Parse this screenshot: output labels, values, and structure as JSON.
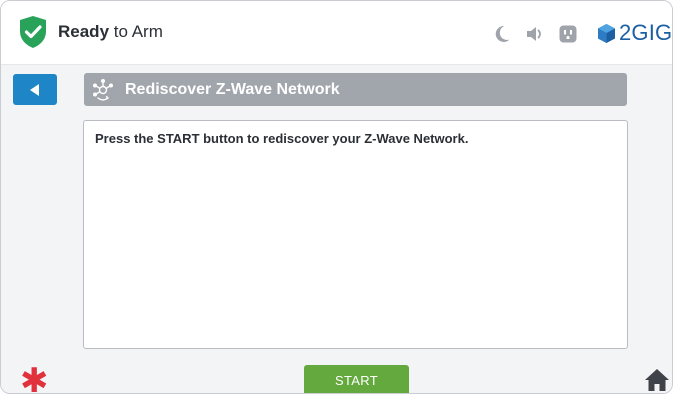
{
  "status": {
    "state_bold": "Ready",
    "state_rest": " to Arm",
    "icons": [
      "shield-check-icon",
      "moon-icon",
      "speaker-icon",
      "power-outlet-icon"
    ]
  },
  "brand": {
    "logo_text": "2GIG"
  },
  "header": {
    "back_icon": "back-arrow-icon",
    "title": "Rediscover Z-Wave Network",
    "title_icon": "zwave-network-icon"
  },
  "message": {
    "text": "Press the START button to rediscover your Z-Wave Network."
  },
  "footer": {
    "star_icon": "emergency-star-icon",
    "start_label": "START",
    "home_icon": "home-icon"
  },
  "colors": {
    "shield": "#2aa35a",
    "back_button": "#1e86c7",
    "title_bar": "#a1a5ac",
    "start_button": "#64a93e",
    "emergency": "#e0313c",
    "brand": "#1d5fa3"
  }
}
